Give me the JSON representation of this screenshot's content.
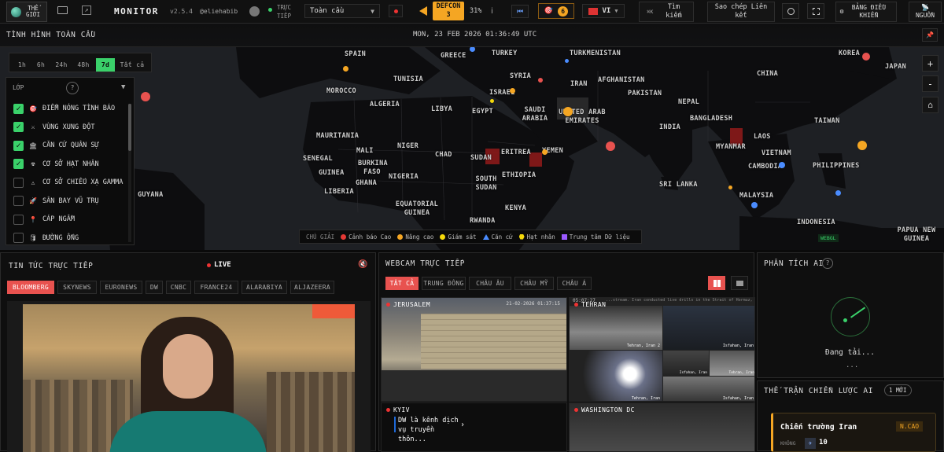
{
  "topbar": {
    "view_world": "THẾ GIỚI",
    "app_name": "MONITOR",
    "version": "v2.5.4",
    "handle": "@eliehabib",
    "live_label": "TRỰC TIẾP",
    "region_select": "Toàn cầu",
    "defcon": "DEFCON 3",
    "defcon_pct": "31%",
    "alert_count": "6",
    "language": "VI",
    "search": "Tìm kiếm",
    "copy_link": "Sao chép Liên kết",
    "dashboard": "BẢNG ĐIỀU KHIỂN",
    "sources": "NGUỒN"
  },
  "map": {
    "title": "TÌNH HÌNH TOÀN CẦU",
    "datetime": "MON, 23 FEB 2026 01:36:49 UTC",
    "time_ranges": [
      "1h",
      "6h",
      "24h",
      "48h",
      "7d",
      "Tất cả"
    ],
    "active_range": "7d",
    "layers_title": "LỚP",
    "help": "?",
    "layers": [
      {
        "label": "ĐIỂM NÓNG TÌNH BÁO",
        "checked": true,
        "icon": "🎯"
      },
      {
        "label": "VÙNG XUNG ĐỘT",
        "checked": true,
        "icon": "⚔"
      },
      {
        "label": "CĂN CỨ QUÂN SỰ",
        "checked": true,
        "icon": "🏛"
      },
      {
        "label": "CƠ SỞ HẠT NHÂN",
        "checked": true,
        "icon": "☢"
      },
      {
        "label": "CƠ SỞ CHIẾU XẠ GAMMA",
        "checked": false,
        "icon": "⚠"
      },
      {
        "label": "SÂN BAY VŨ TRỤ",
        "checked": false,
        "icon": "🚀"
      },
      {
        "label": "CÁP NGẦM",
        "checked": false,
        "icon": "📍"
      },
      {
        "label": "ĐƯỜNG ỐNG",
        "checked": false,
        "icon": "🛢"
      }
    ],
    "legend_title": "CHÚ GIẢI",
    "legend": [
      {
        "label": "Cảnh báo Cao",
        "color": "#e53935",
        "shape": "circle"
      },
      {
        "label": "Nâng cao",
        "color": "#f5a623",
        "shape": "circle"
      },
      {
        "label": "Giám sát",
        "color": "#f5d90a",
        "shape": "circle"
      },
      {
        "label": "Căn cứ",
        "color": "#4a8cff",
        "shape": "triangle"
      },
      {
        "label": "Hạt nhân",
        "color": "#f5d90a",
        "shape": "hex"
      },
      {
        "label": "Trung tâm Dữ liệu",
        "color": "#9b59ff",
        "shape": "square"
      }
    ],
    "countries": [
      "SPAIN",
      "GREECE",
      "TURKEY",
      "TURKMENISTAN",
      "KOREA",
      "JAPAN",
      "TUNISIA",
      "SYRIA",
      "MOROCCO",
      "ISRAEL",
      "IRAN",
      "AFGHANISTAN",
      "CHINA",
      "ALGERIA",
      "LIBYA",
      "EGYPT",
      "SAUDI ARABIA",
      "UNITED ARAB EMIRATES",
      "PAKISTAN",
      "NEPAL",
      "MAURITANIA",
      "MALI",
      "NIGER",
      "CHAD",
      "SUDAN",
      "ERITREA",
      "YEMEN",
      "INDIA",
      "BANGLADESH",
      "MYANMAR",
      "LAOS",
      "TAIWAN",
      "SENEGAL",
      "GUINEA",
      "BURKINA FASO",
      "GHANA",
      "NIGERIA",
      "ETHIOPIA",
      "VIETNAM",
      "PHILIPPINES",
      "CAMBODIA",
      "LIBERIA",
      "SOUTH SUDAN",
      "SRI LANKA",
      "MALAYSIA",
      "GUYANA",
      "EQUATORIAL GUINEA",
      "KENYA",
      "RWANDA",
      "INDONESIA",
      "PAPUA NEW GUINEA"
    ],
    "zoom_in": "+",
    "zoom_out": "-",
    "home": "⌂",
    "webgl": "WEBGL"
  },
  "news": {
    "title": "TIN TỨC TRỰC TIẾP",
    "live": "LIVE",
    "channels": [
      "BLOOMBERG",
      "SKYNEWS",
      "EURONEWS",
      "DW",
      "CNBC",
      "FRANCE24",
      "ALARABIYA",
      "ALJAZEERA"
    ],
    "active": "BLOOMBERG"
  },
  "webcam": {
    "title": "WEBCAM TRỰC TIẾP",
    "filters": [
      "TẤT CẢ",
      "TRUNG ĐÔNG",
      "CHÂU ÂU",
      "CHÂU MỸ",
      "CHÂU Á"
    ],
    "active": "TẤT CẢ",
    "cams": [
      "JERUSALEM",
      "TEHRAN",
      "KYIV",
      "WASHINGTON DC"
    ],
    "jerusalem_ts": "21-02-2026 01:37:15",
    "kyiv_caption": "DW là kênh dịch vụ truyền thôn...",
    "tehran_ts": "05:07:27",
    "tehran_scroll": "...stream. Iran conducted live drills in the Strait of Hormuz, a strategic waterway t...",
    "tehran_tiles": [
      "Tehran, Iran 2",
      "Isfahan, Iran",
      "Tehran, Iran",
      "Isfahan, Iran",
      "Tehran, Iran",
      "Isfahan, Iran"
    ]
  },
  "ai": {
    "title": "PHÂN TÍCH AI",
    "help": "?",
    "loading": "Đang tải...",
    "dots": "...",
    "strategy_title": "THẾ TRẬN CHIẾN LƯỢC AI",
    "new_badge": "1 MỚI",
    "card_title": "Chiến trường Iran",
    "card_level": "N.CAO",
    "card_sub": "KHÔNG",
    "card_value": "10"
  }
}
